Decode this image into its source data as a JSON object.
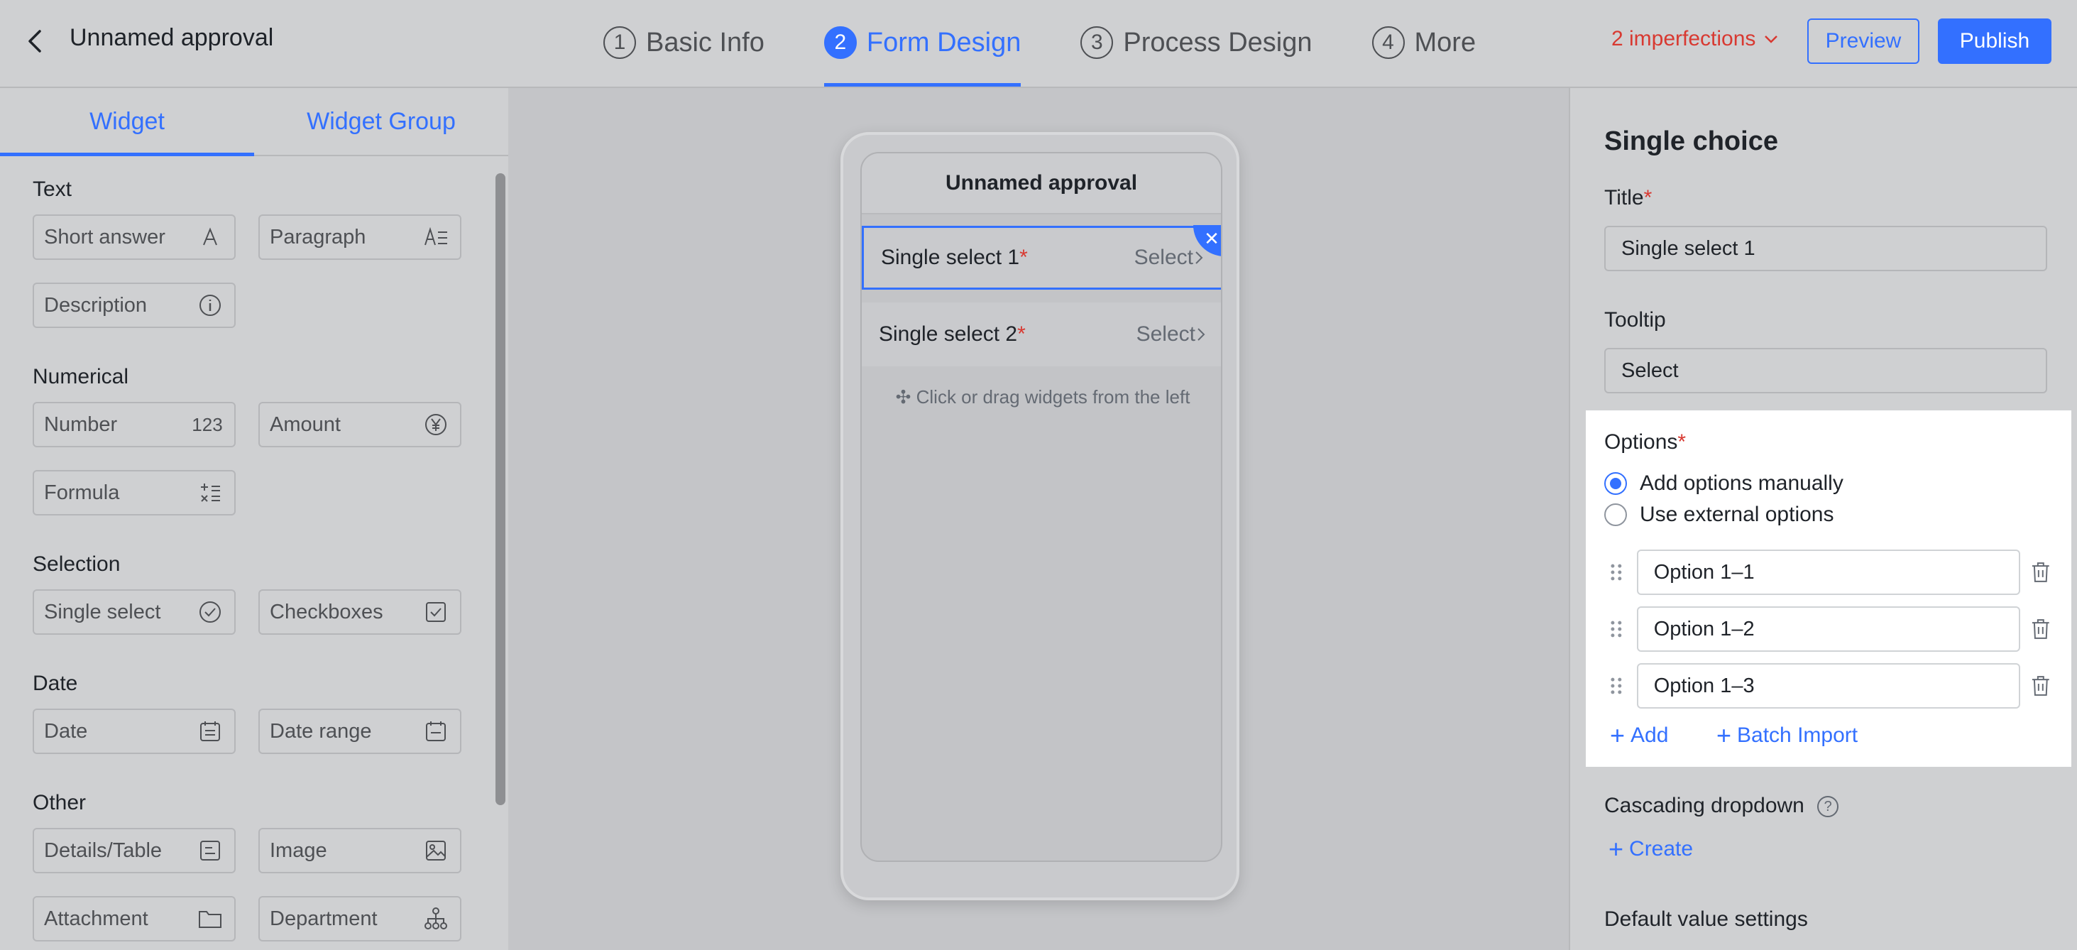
{
  "header": {
    "title": "Unnamed approval",
    "steps": [
      {
        "num": "1",
        "label": "Basic Info"
      },
      {
        "num": "2",
        "label": "Form Design"
      },
      {
        "num": "3",
        "label": "Process Design"
      },
      {
        "num": "4",
        "label": "More"
      }
    ],
    "imperfections": "2 imperfections",
    "preview": "Preview",
    "publish": "Publish"
  },
  "left": {
    "tabs": [
      "Widget",
      "Widget Group"
    ],
    "groups": {
      "text": {
        "title": "Text",
        "items": [
          "Short answer",
          "Paragraph",
          "Description"
        ]
      },
      "numerical": {
        "title": "Numerical",
        "items": [
          "Number",
          "Amount",
          "Formula"
        ],
        "number_icon": "123"
      },
      "selection": {
        "title": "Selection",
        "items": [
          "Single select",
          "Checkboxes"
        ]
      },
      "date": {
        "title": "Date",
        "items": [
          "Date",
          "Date range"
        ]
      },
      "other": {
        "title": "Other",
        "items": [
          "Details/Table",
          "Image",
          "Attachment",
          "Department"
        ]
      }
    }
  },
  "canvas": {
    "title": "Unnamed approval",
    "fields": [
      {
        "label": "Single select 1",
        "placeholder": "Select"
      },
      {
        "label": "Single select 2",
        "placeholder": "Select"
      }
    ],
    "required_mark": "*",
    "hint": "Click or drag widgets from the left"
  },
  "right": {
    "title": "Single choice",
    "title_label": "Title",
    "title_value": "Single select 1",
    "tooltip_label": "Tooltip",
    "tooltip_value": "Select",
    "options_label": "Options",
    "radio_manual": "Add options manually",
    "radio_external": "Use external options",
    "options": [
      "Option 1–1",
      "Option 1–2",
      "Option 1–3"
    ],
    "add": "Add",
    "batch_import": "Batch Import",
    "cascading_label": "Cascading dropdown",
    "create": "Create",
    "default_label": "Default value settings",
    "required_mark": "*"
  },
  "colors": {
    "accent": "#3370ff",
    "error": "#d83931"
  }
}
